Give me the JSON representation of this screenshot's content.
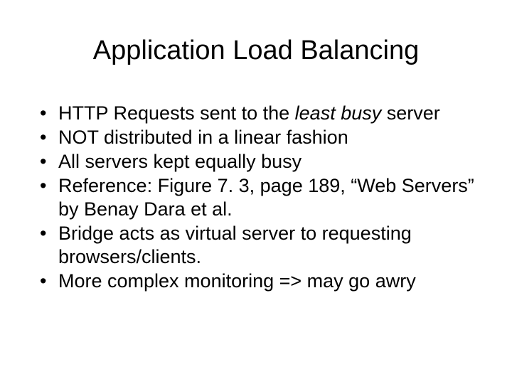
{
  "title": "Application Load Balancing",
  "bullets": [
    {
      "pre": "HTTP Requests sent to the ",
      "italic": "least busy",
      "post": " server"
    },
    {
      "pre": "NOT distributed in a linear fashion",
      "italic": "",
      "post": ""
    },
    {
      "pre": "All servers kept equally busy",
      "italic": "",
      "post": ""
    },
    {
      "pre": "Reference: Figure 7. 3, page 189, “Web Servers” by Benay Dara et al.",
      "italic": "",
      "post": ""
    },
    {
      "pre": "Bridge acts as virtual server to requesting browsers/clients.",
      "italic": "",
      "post": ""
    },
    {
      "pre": "More complex monitoring => may go awry",
      "italic": "",
      "post": ""
    }
  ]
}
